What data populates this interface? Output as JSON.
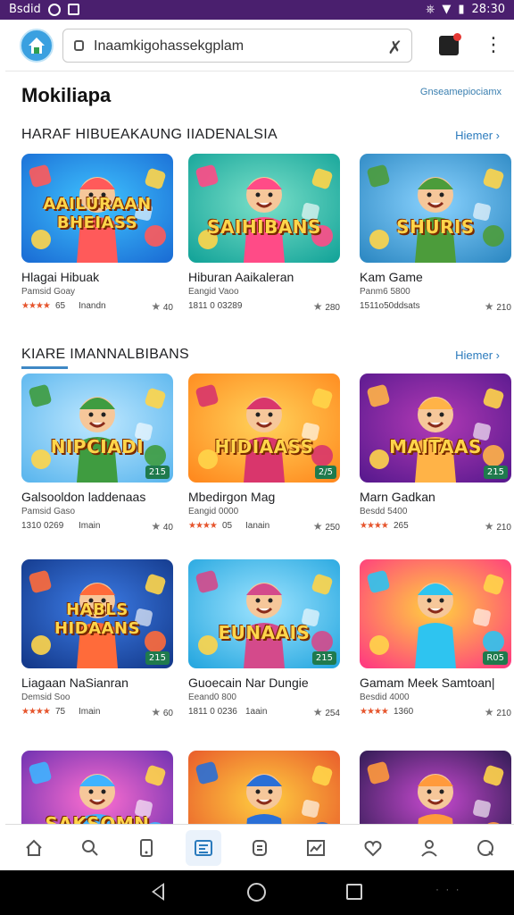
{
  "status_bar": {
    "carrier": "Bsdid",
    "time": "28:30"
  },
  "top_bar": {
    "search_value": "Inaamkigohassekgplam",
    "search_icon_clear": "✗"
  },
  "page": {
    "heading": "Mokiliapa",
    "top_link": "Gnseamepiociamx"
  },
  "sections": [
    {
      "title": "HARAF HIBUEAKAUNG IIADENALSIA",
      "more": "Hiemer ›",
      "cards": [
        {
          "name": "Hlagai Hibuak",
          "sub": "Pamsid Goay",
          "stars": "★★★★",
          "meta_left": "65",
          "meta_mid": "Inandn",
          "meta_right": "40",
          "thumb_text": "AAILURAAN BHEIASS",
          "thumb_theme": "blue"
        },
        {
          "name": "Hiburan Aaikaleran",
          "sub": "Eangid Vaoo",
          "stars": "",
          "meta_left": "1811 0 03289",
          "meta_mid": "",
          "meta_right": "280",
          "thumb_text": "SAIHIBANS",
          "thumb_theme": "teal"
        },
        {
          "name": "Kam Game",
          "sub": "Panm6 5800",
          "stars": "",
          "meta_left": "1511o50ddsats",
          "meta_mid": "",
          "meta_right": "210",
          "thumb_text": "SHURIS",
          "thumb_theme": "green"
        }
      ]
    },
    {
      "title": "KIARE IMANNALBIBANS",
      "more": "Hiemer ›",
      "cards": [
        {
          "name": "Galsooldon laddenaas",
          "sub": "Pamsid Gaso",
          "stars": "",
          "meta_left": "1310 0269",
          "meta_mid": "Imain",
          "meta_right": "40",
          "thumb_text": "NIPCIADI",
          "thumb_theme": "meadow",
          "badge": "215"
        },
        {
          "name": "Mbedirgon Mag",
          "sub": "Eangid 0000",
          "stars": "★★★★",
          "meta_left": "05",
          "meta_mid": "Ianain",
          "meta_right": "250",
          "thumb_text": "HIDIAASS",
          "thumb_theme": "orange",
          "badge": "2/5"
        },
        {
          "name": "Marn Gadkan",
          "sub": "Besdd 5400",
          "stars": "★★★★",
          "meta_left": "265",
          "meta_mid": "",
          "meta_right": "210",
          "thumb_text": "MAITAAS",
          "thumb_theme": "purple",
          "badge": "215"
        }
      ]
    },
    {
      "title": "",
      "more": "",
      "cards": [
        {
          "name": "Liagaan NaSianran",
          "sub": "Demsid Soo",
          "stars": "★★★★",
          "meta_left": "75",
          "meta_mid": "Imain",
          "meta_right": "60",
          "thumb_text": "HABLS HIDAANS",
          "thumb_theme": "navy",
          "badge": "215"
        },
        {
          "name": "Guoecain Nar Dungie",
          "sub": "Eeand0 800",
          "stars": "",
          "meta_left": "1811 0 0236",
          "meta_mid": "1aain",
          "meta_right": "254",
          "thumb_text": "EUNAAIS",
          "thumb_theme": "sky",
          "badge": "215"
        },
        {
          "name": "Gamam Meek Samtoan|",
          "sub": "Besdid 4000",
          "stars": "★★★★",
          "meta_left": "1360",
          "meta_mid": "",
          "meta_right": "210",
          "thumb_text": "",
          "thumb_theme": "rainbow",
          "badge": "R05"
        }
      ]
    },
    {
      "title": "",
      "more": "",
      "cards": [
        {
          "thumb_text": "SAKSOMN",
          "thumb_theme": "violet"
        },
        {
          "thumb_text": "",
          "thumb_theme": "warm"
        },
        {
          "thumb_text": "",
          "thumb_theme": "dusk"
        }
      ]
    }
  ],
  "nav": [
    {
      "icon": "home-icon"
    },
    {
      "icon": "search-icon"
    },
    {
      "icon": "phone-icon"
    },
    {
      "icon": "grid-icon",
      "active": true
    },
    {
      "icon": "chat-icon"
    },
    {
      "icon": "chart-icon"
    },
    {
      "icon": "heart-icon"
    },
    {
      "icon": "person-icon"
    },
    {
      "icon": "help-icon"
    }
  ]
}
